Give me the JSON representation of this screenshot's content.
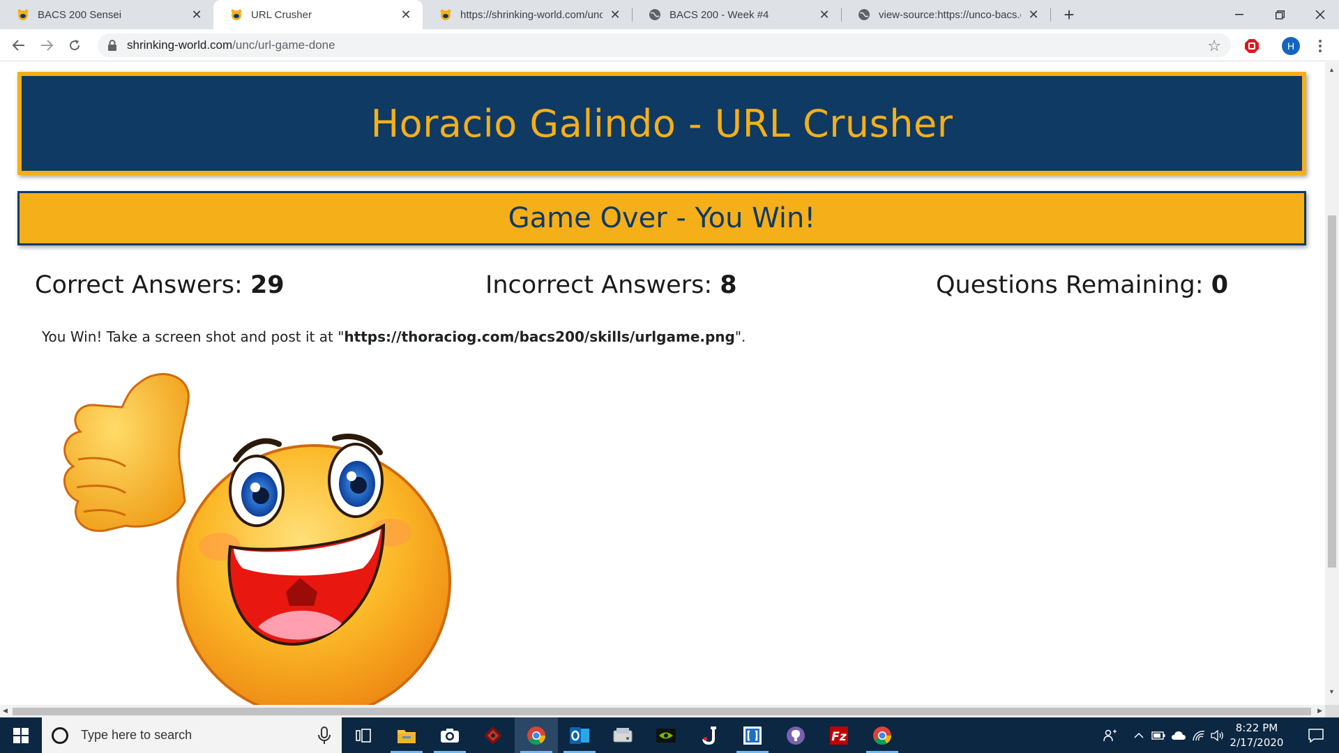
{
  "browser": {
    "tabs": [
      {
        "title": "BACS 200 Sensei",
        "favicon": "bear-icon",
        "active": false
      },
      {
        "title": "URL Crusher",
        "favicon": "bear-icon",
        "active": true
      },
      {
        "title": "https://shrinking-world.com/unc/",
        "favicon": "bear-icon",
        "active": false
      },
      {
        "title": "BACS 200 - Week #4",
        "favicon": "globe-icon",
        "active": false
      },
      {
        "title": "view-source:https://unco-bacs.or",
        "favicon": "globe-icon",
        "active": false
      }
    ],
    "new_tab": "+",
    "address": {
      "host": "shrinking-world.com",
      "path": "/unc/url-game-done"
    },
    "profile_initial": "H"
  },
  "page": {
    "banner_title": "Horacio Galindo - URL Crusher",
    "status_title": "Game Over - You Win!",
    "stats": [
      {
        "label": "Correct Answers: ",
        "value": "29"
      },
      {
        "label": "Incorrect Answers: ",
        "value": "8"
      },
      {
        "label": "Questions Remaining: ",
        "value": "0"
      }
    ],
    "message": {
      "prefix": "You Win! Take a screen shot and post it at \"",
      "link": "https://thoraciog.com/bacs200/skills/urlgame.png",
      "suffix": "\"."
    },
    "image": "thumbs-up-smiley-icon"
  },
  "taskbar": {
    "search_placeholder": "Type here to search",
    "apps": [
      "chrome-icon",
      "outlook-icon",
      "file-explorer-icon",
      "camera-icon",
      "game-icon",
      "chrome-icon",
      "outlook-icon",
      "disk-icon",
      "nvidia-icon",
      "j-icon",
      "bracket-app-icon",
      "github-icon",
      "filezilla-icon",
      "chrome-icon"
    ],
    "time": "8:22 PM",
    "date": "2/17/2020"
  },
  "colors": {
    "navy": "#0f3a63",
    "gold": "#f5af19"
  }
}
